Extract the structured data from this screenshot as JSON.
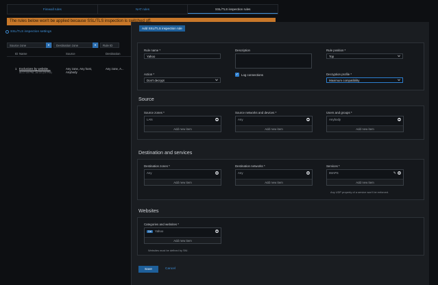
{
  "tabs": [
    "Firewall rules",
    "NAT rules",
    "SSL/TLS inspection rules"
  ],
  "warning": "The rules below won't be applied because SSL/TLS inspection is switched off.",
  "settings_link": "SSL/TLS inspection settings",
  "filters": {
    "source_zone": "Source zone",
    "destination_zone": "Destination zone",
    "rule_id": "Rule ID"
  },
  "table": {
    "headers": [
      "ID",
      "Name",
      "Source",
      "Destination"
    ],
    "row": {
      "id": "1",
      "name": "Exclusions by website...",
      "sub": "At 17:19 PM, Jul 22 (09 PM)",
      "source_1": "Any zone, Any host,",
      "source_2": "Anybody",
      "destination": "Any zone, A..."
    }
  },
  "panel": {
    "title": "Add SSL/TLS inspection rule",
    "rule_name_label": "Rule name *",
    "rule_name_value": "Yahoo",
    "description_label": "Description",
    "rule_position_label": "Rule position *",
    "rule_position_value": "Top",
    "action_label": "Action *",
    "action_value": "Don't decrypt",
    "log_connections": "Log connections",
    "decryption_profile_label": "Decryption profile *",
    "decryption_profile_value": "Maximum compatibility",
    "source": {
      "title": "Source",
      "zones_label": "Source zones *",
      "zones_value": "LAN",
      "networks_label": "Source networks and devices *",
      "networks_value": "Any",
      "users_label": "Users and groups *",
      "users_value": "Anybody"
    },
    "destination": {
      "title": "Destination and services",
      "zones_label": "Destination zones *",
      "zones_value": "Any",
      "networks_label": "Destination networks *",
      "networks_value": "Any",
      "services_label": "Services *",
      "services_value": "IMAPS",
      "services_hint": "Any UDP property of a service won't be enforced."
    },
    "websites": {
      "title": "Websites",
      "label": "Categories and websites *",
      "tag": "Cat",
      "value": "Yahoo",
      "hint": "Websites must be defined by SNI."
    },
    "add_new_item": "Add new item",
    "save": "Save",
    "cancel": "Cancel"
  }
}
